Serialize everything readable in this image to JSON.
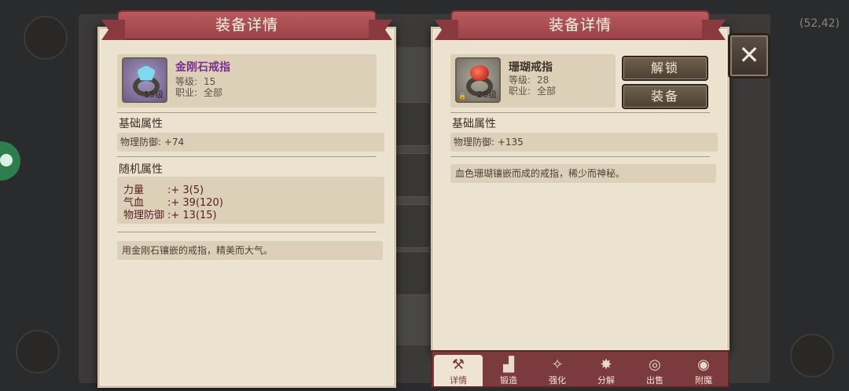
{
  "background": {
    "coord_text": "(52,42)"
  },
  "left_panel": {
    "title": "装备详情",
    "item": {
      "name": "金刚石戒指",
      "level_badge": "15级",
      "level_label": "等级:",
      "level_value": "15",
      "class_label": "职业:",
      "class_value": "全部",
      "icon": "diamond-ring-icon",
      "name_color": "#7a2e8c"
    },
    "base_title": "基础属性",
    "base_stat": "物理防御: +74",
    "random_title": "随机属性",
    "random_stats": [
      {
        "name": "力量",
        "value": ":+ 3(5)"
      },
      {
        "name": "气血",
        "value": ":+ 39(120)"
      },
      {
        "name": "物理防御",
        "value": ":+ 13(15)"
      }
    ],
    "description": "用金刚石镶嵌的戒指，精美而大气。"
  },
  "right_panel": {
    "title": "装备详情",
    "item": {
      "name": "珊瑚戒指",
      "level_badge": "28级",
      "level_label": "等级:",
      "level_value": "28",
      "class_label": "职业:",
      "class_value": "全部",
      "icon": "coral-ring-icon",
      "name_color": "#3a3128"
    },
    "unlock_button": "解锁",
    "equip_button": "装备",
    "base_title": "基础属性",
    "base_stat": "物理防御: +135",
    "description": "血色珊瑚镶嵌而成的戒指，稀少而神秘。"
  },
  "tabs": [
    {
      "label": "详情",
      "icon": "hammer-cross-icon",
      "active": true
    },
    {
      "label": "锻造",
      "icon": "anvil-icon",
      "active": false
    },
    {
      "label": "强化",
      "icon": "sparkle-icon",
      "active": false
    },
    {
      "label": "分解",
      "icon": "burst-icon",
      "active": false
    },
    {
      "label": "出售",
      "icon": "coins-icon",
      "active": false
    },
    {
      "label": "附魔",
      "icon": "eye-icon",
      "active": false
    }
  ],
  "colors": {
    "ribbon": "#9c4448",
    "panel": "#ece2d0",
    "tabbar": "#7b3a3e"
  }
}
